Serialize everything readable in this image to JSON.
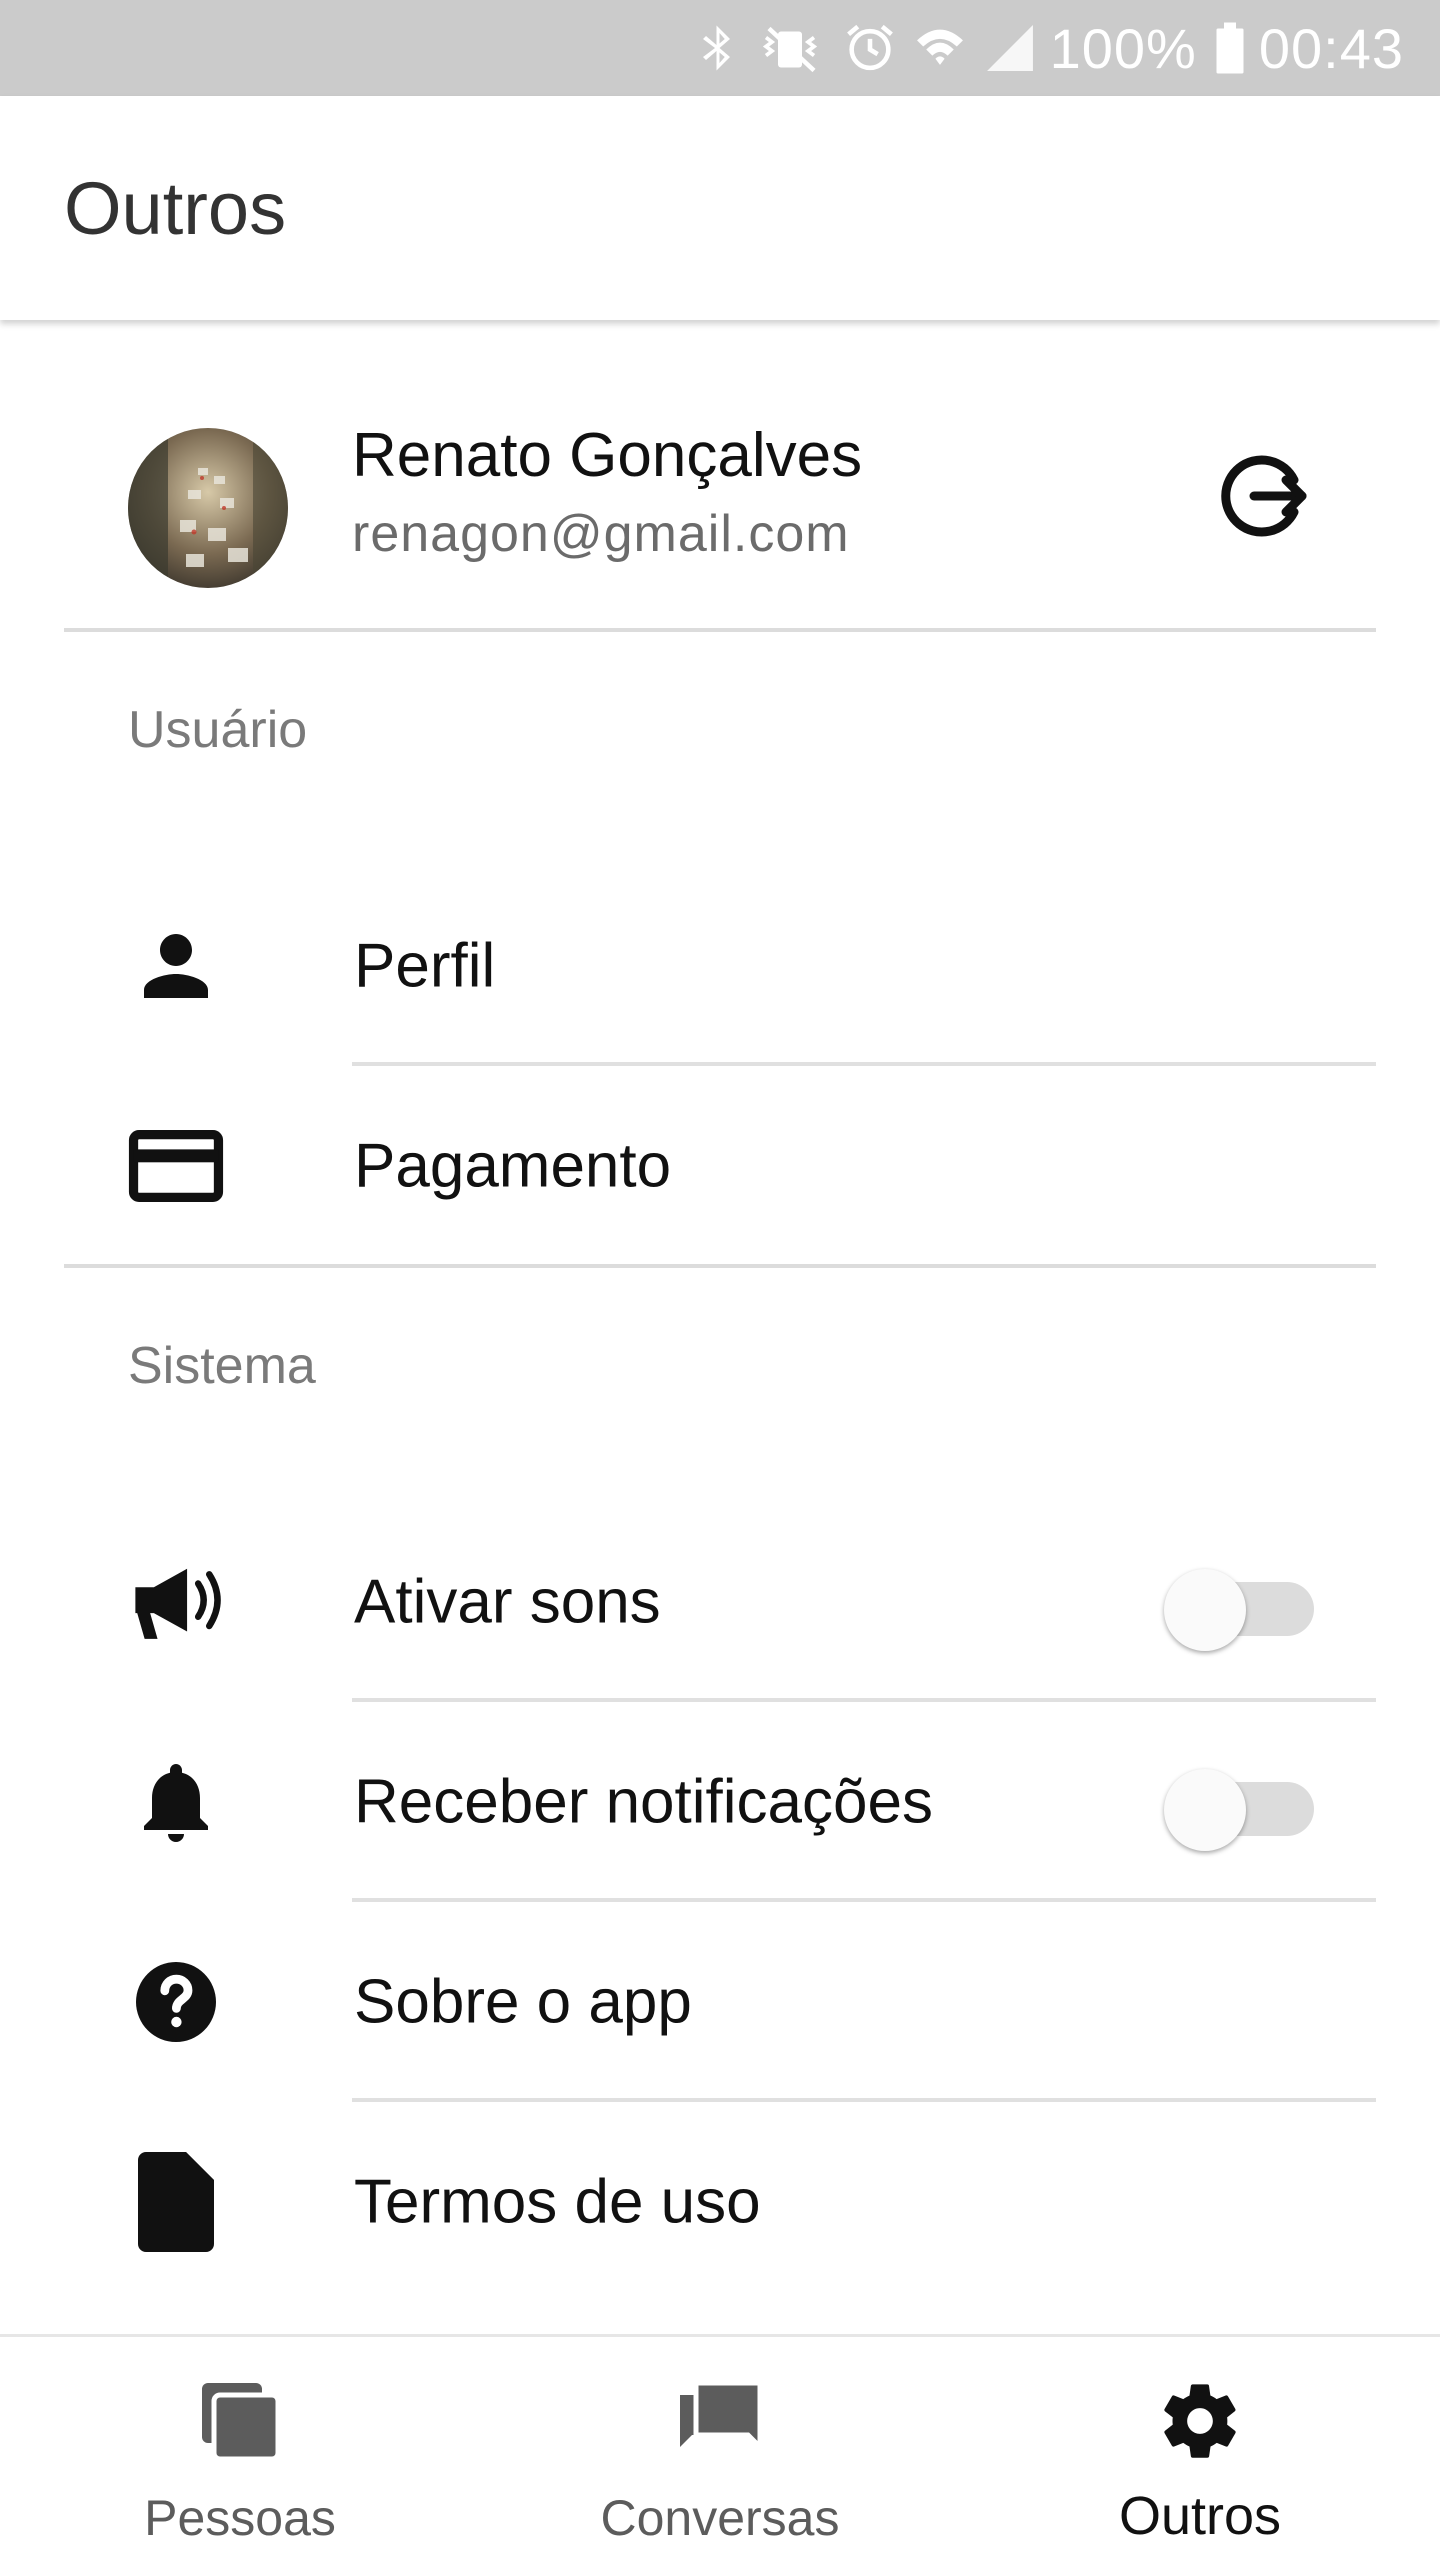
{
  "status_bar": {
    "battery_percent": "100%",
    "time": "00:43",
    "icons": [
      "bluetooth-icon",
      "vibrate-mute-icon",
      "alarm-icon",
      "wifi-icon",
      "signal-icon",
      "battery-icon"
    ]
  },
  "app_bar": {
    "title": "Outros"
  },
  "user": {
    "name": "Renato Gonçalves",
    "email": "renagon@gmail.com",
    "logout_icon": "logout-icon"
  },
  "sections": {
    "usuario": {
      "header": "Usuário",
      "items": [
        {
          "label": "Perfil",
          "icon": "person-icon"
        },
        {
          "label": "Pagamento",
          "icon": "credit-card-icon"
        }
      ]
    },
    "sistema": {
      "header": "Sistema",
      "items": [
        {
          "label": "Ativar sons",
          "icon": "megaphone-icon",
          "toggle": false
        },
        {
          "label": "Receber notificações",
          "icon": "bell-icon",
          "toggle": false
        },
        {
          "label": "Sobre o app",
          "icon": "help-circle-icon"
        },
        {
          "label": "Termos de uso",
          "icon": "document-icon"
        }
      ]
    }
  },
  "bottom_nav": {
    "tabs": [
      {
        "label": "Pessoas",
        "icon": "cards-icon",
        "active": false
      },
      {
        "label": "Conversas",
        "icon": "chat-icon",
        "active": false
      },
      {
        "label": "Outros",
        "icon": "gear-icon",
        "active": true
      }
    ]
  },
  "colors": {
    "status_bar_bg": "#cbcbcb",
    "divider": "#dcdcdc",
    "secondary_text": "#6b6b6b",
    "toggle_track_off": "#dcdcdc"
  }
}
